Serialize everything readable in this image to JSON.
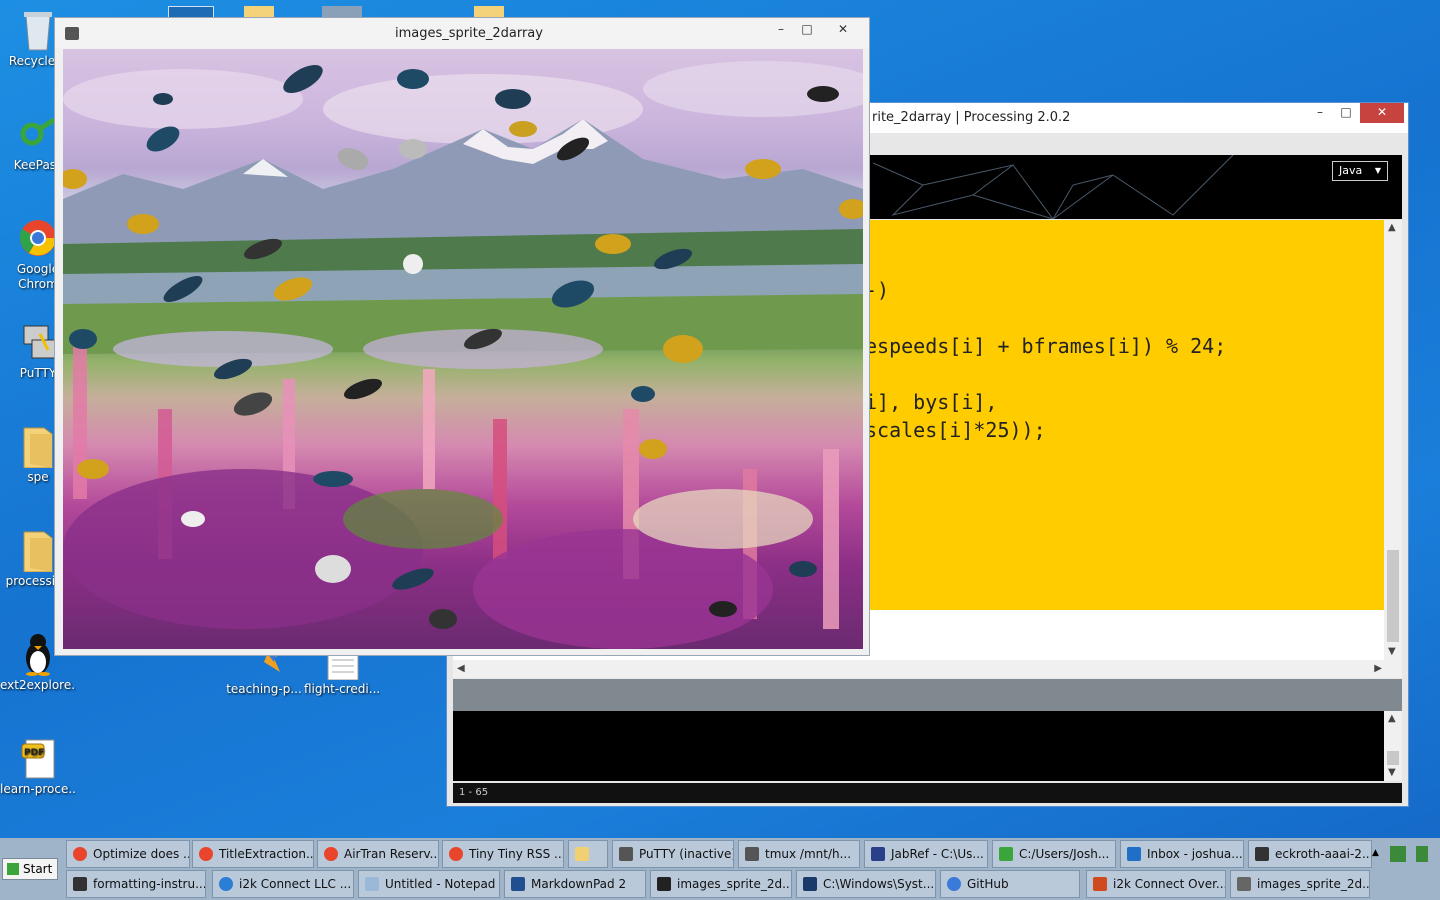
{
  "desktop": {
    "icons": [
      {
        "label": "Recycle B",
        "icon": "recycle-bin-icon"
      },
      {
        "label": "KeePass",
        "icon": "keepass-icon"
      },
      {
        "label": "Google Chrom",
        "icon": "chrome-icon"
      },
      {
        "label": "PuTTY",
        "icon": "putty-icon"
      },
      {
        "label": "spe",
        "icon": "folder-icon"
      },
      {
        "label": "processing",
        "icon": "folder-icon"
      },
      {
        "label": "ext2explore...",
        "icon": "penguin-icon"
      },
      {
        "label": "learn-proce...",
        "icon": "pdf-icon"
      },
      {
        "label": "teaching-p...",
        "icon": "file-icon"
      },
      {
        "label": "flight-credi...",
        "icon": "document-icon"
      }
    ]
  },
  "sketch_window": {
    "title": "images_sprite_2darray",
    "minimize": "–",
    "maximize": "□",
    "close": "✕"
  },
  "ide_window": {
    "title": "rite_2darray | Processing 2.0.2",
    "mode": "Java",
    "code_lines": [
      "-)",
      "espeeds[i] + bframes[i]) % 24;",
      "i], bys[i],",
      "scales[i]*25));"
    ],
    "status": "1 - 65",
    "minimize": "–",
    "maximize": "□",
    "close": "✕"
  },
  "taskbar": {
    "start": "Start",
    "row1": [
      {
        "label": "Optimize does ...",
        "icon": "chrome-icon",
        "color": "#e8452c"
      },
      {
        "label": "TitleExtraction...",
        "icon": "chrome-icon",
        "color": "#e8452c"
      },
      {
        "label": "AirTran Reserv...",
        "icon": "chrome-icon",
        "color": "#e8452c"
      },
      {
        "label": "Tiny Tiny RSS ...",
        "icon": "chrome-icon",
        "color": "#e8452c"
      },
      {
        "label": "",
        "icon": "explorer-icon",
        "color": "#f0d070"
      },
      {
        "label": "PuTTY (inactive)",
        "icon": "putty-icon",
        "color": "#555555"
      },
      {
        "label": "tmux /mnt/h...",
        "icon": "putty-icon",
        "color": "#555555"
      },
      {
        "label": "JabRef - C:\\Us...",
        "icon": "jabref-icon",
        "color": "#2a3f8a"
      },
      {
        "label": "C:/Users/Josh...",
        "icon": "keepass-icon",
        "color": "#3aa53a"
      },
      {
        "label": "Inbox - joshua...",
        "icon": "outlook-icon",
        "color": "#1e6fc5"
      },
      {
        "label": "eckroth-aaai-2...",
        "icon": "document-icon",
        "color": "#333333"
      }
    ],
    "row2": [
      {
        "label": "formatting-instru...",
        "icon": "document-icon",
        "color": "#333333"
      },
      {
        "label": "i2k Connect LLC ...",
        "icon": "ie-icon",
        "color": "#2a7fd4"
      },
      {
        "label": "Untitled - Notepad",
        "icon": "notepad-icon",
        "color": "#9ab8d8"
      },
      {
        "label": "MarkdownPad 2",
        "icon": "markdownpad-icon",
        "color": "#1f4f8f"
      },
      {
        "label": "images_sprite_2d...",
        "icon": "processing-icon",
        "color": "#222222"
      },
      {
        "label": "C:\\Windows\\Syst...",
        "icon": "cmd-icon",
        "color": "#1a3a6a"
      },
      {
        "label": "GitHub",
        "icon": "github-icon",
        "color": "#3a7ad8"
      },
      {
        "label": "i2k Connect Over...",
        "icon": "powerpoint-icon",
        "color": "#d04a20"
      },
      {
        "label": "images_sprite_2d...",
        "icon": "processing-icon",
        "color": "#666666"
      }
    ]
  }
}
